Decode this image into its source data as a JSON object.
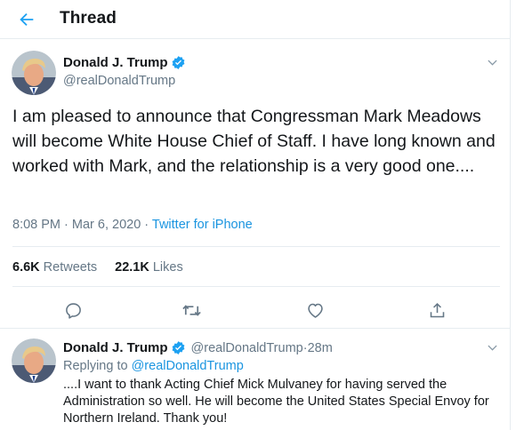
{
  "header": {
    "title": "Thread",
    "back_icon": "arrow-left-icon"
  },
  "colors": {
    "accent": "#1da1f2",
    "link": "#1b95e0",
    "text": "#14171a",
    "secondary": "#657786",
    "border": "#e6ecf0"
  },
  "tweet": {
    "name": "Donald J. Trump",
    "handle": "@realDonaldTrump",
    "verified_icon": "verified-badge-icon",
    "text": "I am pleased to announce that Congressman Mark Meadows will become White House Chief of Staff. I have long known and worked with Mark, and the relationship is a very good one....",
    "time": "8:08 PM",
    "sep1": " · ",
    "date": "Mar 6, 2020",
    "sep2": " · ",
    "source": "Twitter for iPhone",
    "retweets_count": "6.6K",
    "retweets_label": "Retweets",
    "likes_count": "22.1K",
    "likes_label": "Likes",
    "actions": [
      "reply-icon",
      "retweet-icon",
      "like-icon",
      "share-icon"
    ]
  },
  "reply": {
    "name": "Donald J. Trump",
    "handle": "@realDonaldTrump",
    "dot": " · ",
    "time": "28m",
    "replying_prefix": "Replying to ",
    "replying_to": "@realDonaldTrump",
    "text": "....I want to thank Acting Chief Mick Mulvaney for having served the Administration so well. He will become the United States Special Envoy for Northern Ireland. Thank you!"
  }
}
